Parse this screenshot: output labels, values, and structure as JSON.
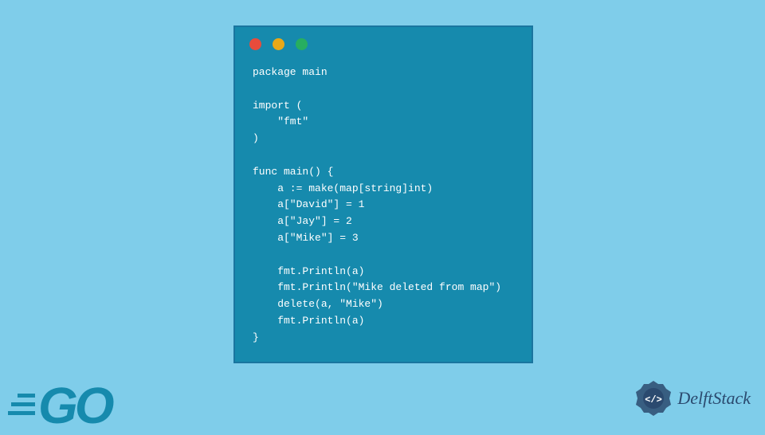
{
  "code": {
    "lines": "package main\n\nimport (\n    \"fmt\"\n)\n\nfunc main() {\n    a := make(map[string]int)\n    a[\"David\"] = 1\n    a[\"Jay\"] = 2\n    a[\"Mike\"] = 3\n\n    fmt.Println(a)\n    fmt.Println(\"Mike deleted from map\")\n    delete(a, \"Mike\")\n    fmt.Println(a)\n}"
  },
  "logos": {
    "go": "GO",
    "delftstack": "DelftStack"
  },
  "colors": {
    "bg": "#7fcdea",
    "window": "#168aad",
    "red": "#e74c3c",
    "yellow": "#e8a817",
    "green": "#27ae60"
  }
}
